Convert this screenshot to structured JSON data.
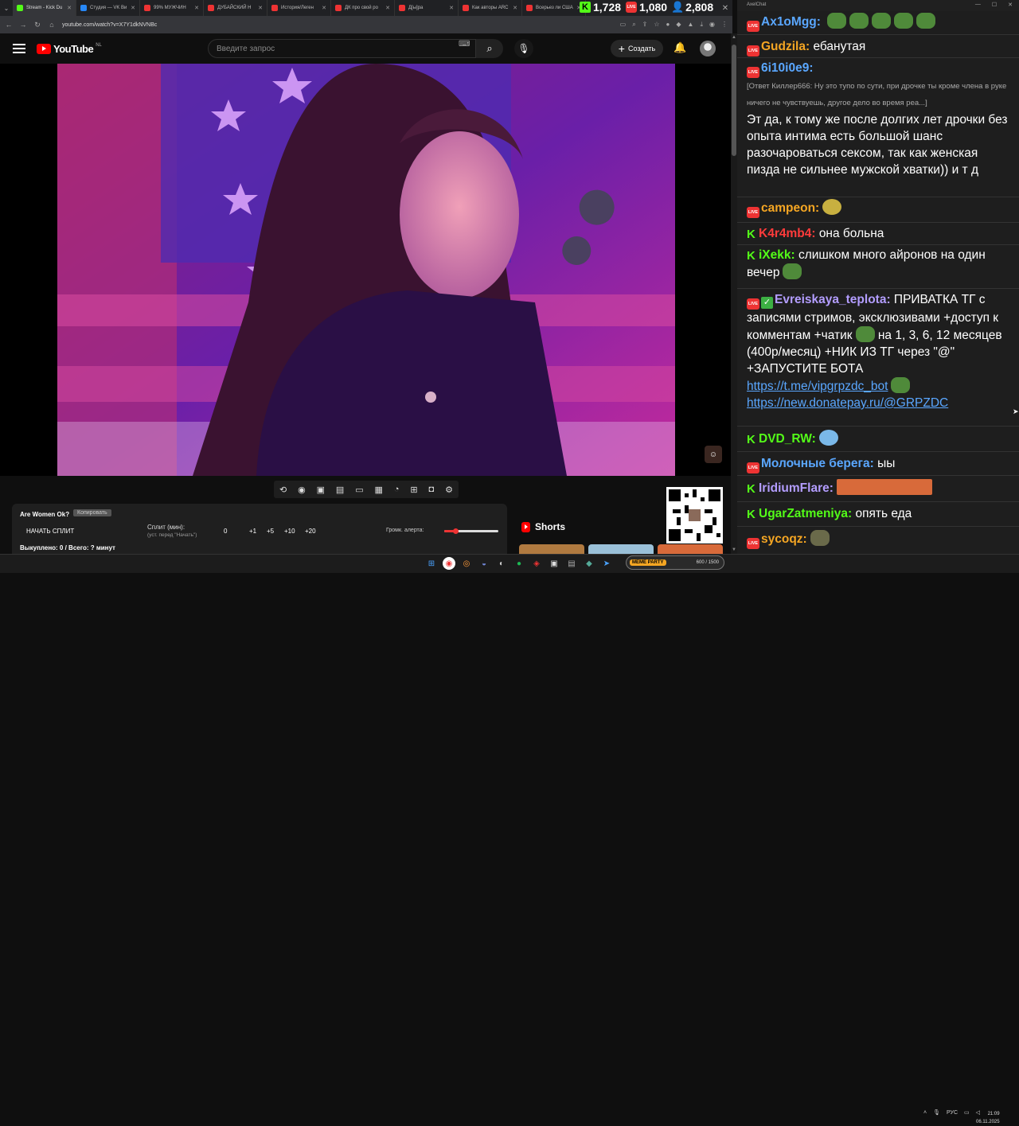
{
  "browser": {
    "tabs": [
      {
        "label": "Stream - Kick Du",
        "icon": "kick"
      },
      {
        "label": "Студия — VK Ви",
        "icon": "vk"
      },
      {
        "label": "99% МУЖЧИН",
        "icon": "youtube"
      },
      {
        "label": "ДУБАЙСКИЙ Н",
        "icon": "youtube"
      },
      {
        "label": "История/Леген",
        "icon": "youtube"
      },
      {
        "label": "ДК про свой ро",
        "icon": "youtube"
      },
      {
        "label": "Д[ы]ра",
        "icon": "youtube"
      },
      {
        "label": "Как авторы ARC",
        "icon": "youtube"
      },
      {
        "label": "Всерьез ли США",
        "icon": "youtube"
      }
    ],
    "url": "youtube.com/watch?v=X7Y1dkNVNBc"
  },
  "counters": {
    "kick": "1,728",
    "live": "1,080",
    "users": "2,808"
  },
  "youtube": {
    "logo": "YouTube",
    "region": "NL",
    "search_placeholder": "Введите запрос",
    "create_label": "Создать",
    "icons": [
      "menu-icon",
      "search-icon",
      "mic-icon",
      "bell-icon"
    ]
  },
  "panel": {
    "title": "Are Women Ok?",
    "tag": "Копировать",
    "start_button": "НАЧАТЬ СПЛИТ",
    "split_label": "Сплит (мин):",
    "split_sub": "(уст. перед \"Начать\")",
    "split_options": [
      "0",
      "+1",
      "+5",
      "+10",
      "+20"
    ],
    "alert_label": "Громк. алерта:",
    "alert_volume": 0.2,
    "bought": "Выкуплено: 0 / Всего: ? минут"
  },
  "shorts": {
    "label": "Shorts"
  },
  "memparty": {
    "label": "MEME PARTY",
    "value": "600 / 1500"
  },
  "taskbar": {
    "lang": "РУС",
    "time": "21:09",
    "date": "06.11.2025"
  },
  "chat": {
    "window_title": "AxelChat",
    "messages": [
      {
        "platform": "live",
        "nick": "Ax1oMgg:",
        "color": "#5aa7ff",
        "text": "",
        "emotes": 5
      },
      {
        "platform": "live",
        "nick": "Gudzila:",
        "color": "#f5a623",
        "text": "ебанутая"
      },
      {
        "platform": "live",
        "nick": "6i10i0e9:",
        "color": "#5aa7ff",
        "reply": "[Ответ Киллер666: Ну это тупо по сути, при дрочке ты кроме члена в руке ничего не чувствуешь, другое дело во время реа...]",
        "text": "Эт да, к тому же после долгих лет дрочки без опыта интима есть большой шанс разочароваться сексом, так как женская пизда не сильнее мужской хватки)) и т д"
      },
      {
        "platform": "live",
        "nick": "campeon:",
        "color": "#f5a623",
        "text": ""
      },
      {
        "platform": "kick",
        "nick": "K4r4mb4:",
        "color": "#ff3b3b",
        "text": "она больна"
      },
      {
        "platform": "kick",
        "nick": "iXekk:",
        "color": "#53fc18",
        "text": "слишком много айронов на один вечер"
      },
      {
        "platform": "live",
        "nick": "Evreiskaya_teplota:",
        "color": "#b39dff",
        "text": "ПРИВАТКА ТГ с записями стримов, эксклюзивами +доступ к комментам +чатик",
        "text2": "на 1, 3, 6, 12 месяцев (400р/месяц) +НИК ИЗ ТГ через \"@\" +ЗАПУСТИТЕ БОТА",
        "link1": "https://t.me/vipgrpzdc_bot",
        "link2": "https://new.donatepay.ru/@GRPZDC"
      },
      {
        "platform": "kick",
        "nick": "DVD_RW:",
        "color": "#53fc18",
        "text": ""
      },
      {
        "platform": "live",
        "nick": "Молочные берега:",
        "color": "#5aa7ff",
        "text": "ыы"
      },
      {
        "platform": "kick",
        "nick": "IridiumFlare:",
        "color": "#b39dff",
        "text": ""
      },
      {
        "platform": "kick",
        "nick": "UgarZatmeniya:",
        "color": "#53fc18",
        "text": "опять еда"
      },
      {
        "platform": "live",
        "nick": "sycoqz:",
        "color": "#f5a623",
        "text": ""
      }
    ]
  }
}
